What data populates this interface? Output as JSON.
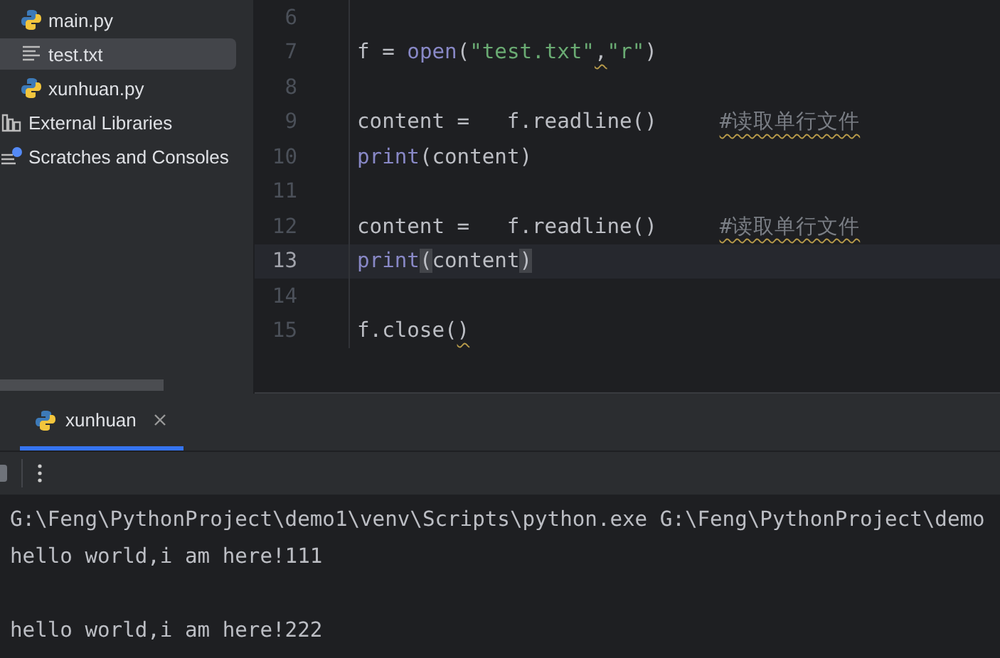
{
  "project_tree": {
    "items": [
      {
        "label": "main.py",
        "kind": "python",
        "selected": false
      },
      {
        "label": "test.txt",
        "kind": "text",
        "selected": true
      },
      {
        "label": "xunhuan.py",
        "kind": "python",
        "selected": false
      },
      {
        "label": "External Libraries",
        "kind": "library",
        "selected": false
      },
      {
        "label": "Scratches and Consoles",
        "kind": "scratches",
        "selected": false
      }
    ]
  },
  "editor": {
    "lines": [
      {
        "number": "6",
        "current": false
      },
      {
        "number": "7",
        "current": false,
        "segments": [
          {
            "text": "f = ",
            "kind": "plain"
          },
          {
            "text": "open",
            "kind": "builtin"
          },
          {
            "text": "(",
            "kind": "plain"
          },
          {
            "text": "\"test.txt\"",
            "kind": "string"
          },
          {
            "text": ",",
            "kind": "plain",
            "warn": true
          },
          {
            "text": "\"r\"",
            "kind": "string"
          },
          {
            "text": ")",
            "kind": "plain"
          }
        ]
      },
      {
        "number": "8",
        "current": false
      },
      {
        "number": "9",
        "current": false,
        "segments": [
          {
            "text": "content =   f.readline()     ",
            "kind": "plain"
          },
          {
            "text": "#读取单行文件",
            "kind": "comment",
            "warn": true
          }
        ]
      },
      {
        "number": "10",
        "current": false,
        "segments": [
          {
            "text": "print",
            "kind": "builtin"
          },
          {
            "text": "(content)",
            "kind": "plain"
          }
        ]
      },
      {
        "number": "11",
        "current": false
      },
      {
        "number": "12",
        "current": false,
        "segments": [
          {
            "text": "content =   f.readline()     ",
            "kind": "plain"
          },
          {
            "text": "#读取单行文件",
            "kind": "comment",
            "warn": true
          }
        ]
      },
      {
        "number": "13",
        "current": true,
        "segments": [
          {
            "text": "print",
            "kind": "builtin"
          },
          {
            "text": "(",
            "kind": "plain",
            "matched": true
          },
          {
            "text": "content",
            "kind": "plain"
          },
          {
            "text": ")",
            "kind": "plain",
            "matched": true
          }
        ]
      },
      {
        "number": "14",
        "current": false
      },
      {
        "number": "15",
        "current": false,
        "segments": [
          {
            "text": "f.close(",
            "kind": "plain"
          },
          {
            "text": ")",
            "kind": "plain",
            "warn": true
          }
        ]
      }
    ]
  },
  "run_panel": {
    "tabs": [
      {
        "label": "xunhuan",
        "selected": true
      }
    ],
    "console": [
      {
        "text": "G:\\Feng\\PythonProject\\demo1\\venv\\Scripts\\python.exe G:\\Feng\\PythonProject\\demo",
        "gap_before": false
      },
      {
        "text": "hello world,i am here!111",
        "gap_before": false
      },
      {
        "text": "hello world,i am here!222",
        "gap_before": true
      }
    ]
  }
}
